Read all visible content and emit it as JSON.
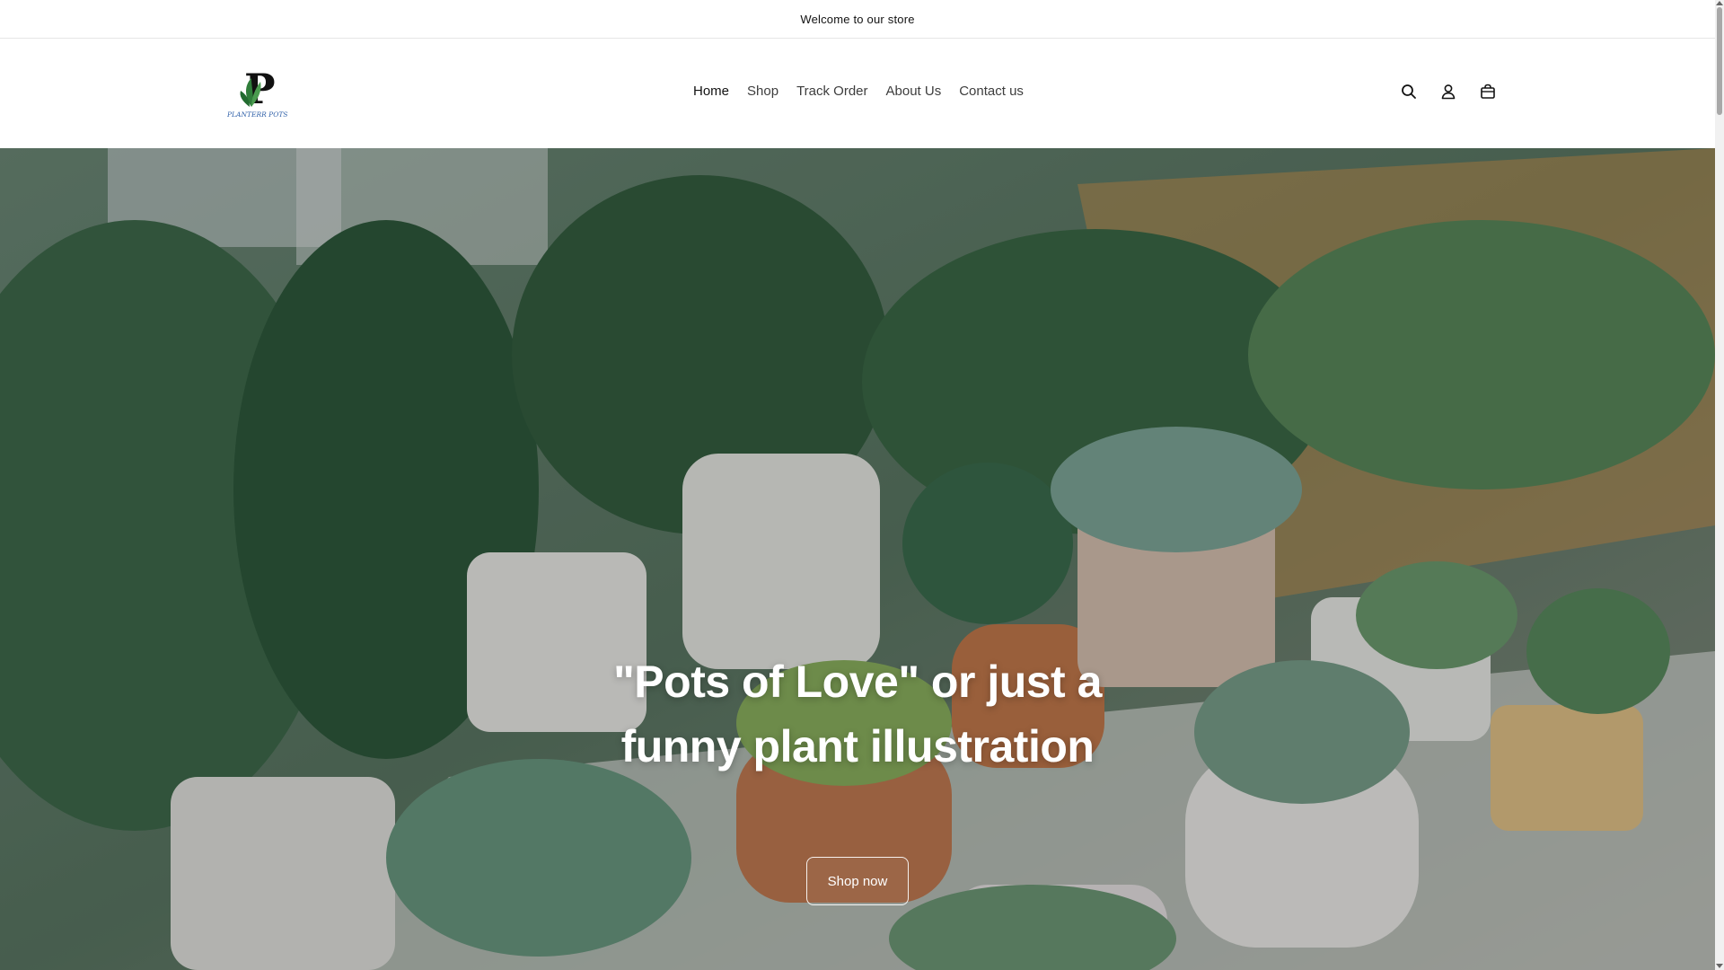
{
  "announcement": {
    "text": "Welcome to our store"
  },
  "brand": {
    "logo_letter": "P",
    "logo_subtext": "PLANTERR POTS"
  },
  "nav": {
    "items": [
      {
        "label": "Home",
        "active": true
      },
      {
        "label": "Shop"
      },
      {
        "label": "Track Order"
      },
      {
        "label": "About Us"
      },
      {
        "label": "Contact us"
      }
    ]
  },
  "header_icons": [
    "search-icon",
    "account-icon",
    "cart-icon"
  ],
  "hero": {
    "heading": "\"Pots of Love\" or just a funny plant illustration",
    "button_label": "Shop now"
  },
  "colors": {
    "text": "#121212",
    "hero_text": "#ffffff",
    "background": "#ffffff"
  }
}
